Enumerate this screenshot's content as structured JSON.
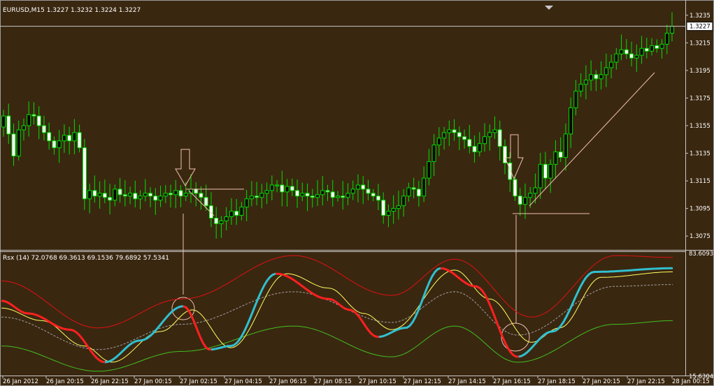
{
  "chart_data": [
    {
      "type": "candlestick",
      "title": "EURUSD,M15  1.3227 1.3232 1.3224 1.3227",
      "ylim": [
        1.3066,
        1.3242
      ],
      "y_ticks": [
        "1.3235",
        "1.3215",
        "1.3195",
        "1.3175",
        "1.3155",
        "1.3135",
        "1.3115",
        "1.3095",
        "1.3075"
      ],
      "last_price": "1.3227",
      "colors": {
        "background": "#3a2710",
        "candle": "#00e000",
        "price_line": "#c8c8c8",
        "annotation": "#f0c0b0"
      },
      "closes": [
        1.3162,
        1.3149,
        1.3133,
        1.3152,
        1.3155,
        1.3163,
        1.3162,
        1.3155,
        1.315,
        1.3144,
        1.3139,
        1.3144,
        1.3148,
        1.3144,
        1.315,
        1.3139,
        1.3102,
        1.3108,
        1.3104,
        1.3106,
        1.3103,
        1.3101,
        1.3109,
        1.3105,
        1.3104,
        1.3106,
        1.3102,
        1.3104,
        1.3106,
        1.3104,
        1.3101,
        1.3104,
        1.3106,
        1.3105,
        1.3108,
        1.3104,
        1.3106,
        1.3109,
        1.3106,
        1.3103,
        1.3097,
        1.3088,
        1.3084,
        1.3086,
        1.3089,
        1.3093,
        1.309,
        1.3096,
        1.3102,
        1.3104,
        1.3103,
        1.3106,
        1.3108,
        1.3112,
        1.3112,
        1.3107,
        1.3111,
        1.3108,
        1.3104,
        1.3106,
        1.3104,
        1.3103,
        1.3105,
        1.3108,
        1.3107,
        1.3103,
        1.3104,
        1.3103,
        1.3106,
        1.3109,
        1.3112,
        1.3109,
        1.3106,
        1.3104,
        1.3101,
        1.309,
        1.3093,
        1.3095,
        1.3097,
        1.3104,
        1.311,
        1.3109,
        1.3104,
        1.3117,
        1.3129,
        1.3141,
        1.3146,
        1.315,
        1.3152,
        1.315,
        1.3147,
        1.3145,
        1.314,
        1.3136,
        1.3142,
        1.3147,
        1.315,
        1.3152,
        1.314,
        1.3128,
        1.3116,
        1.3104,
        1.3098,
        1.3103,
        1.3106,
        1.311,
        1.3127,
        1.3117,
        1.3127,
        1.3136,
        1.3132,
        1.3149,
        1.3168,
        1.318,
        1.3185,
        1.3188,
        1.3192,
        1.3189,
        1.3192,
        1.3197,
        1.3201,
        1.3207,
        1.321,
        1.3207,
        1.3204,
        1.3206,
        1.3211,
        1.3209,
        1.3213,
        1.3211,
        1.3214,
        1.3222,
        1.3227
      ]
    },
    {
      "type": "line",
      "title": "Rsx (14) 72.0768 69.3613 69.1536 79.6892 57.5341",
      "ylim": [
        15.6304,
        83.6093
      ],
      "y_ticks": [
        "83.6093",
        "15.6304"
      ],
      "colors": {
        "upper_band": "#e01010",
        "middle": "#a0a0a0",
        "lower_band": "#40c020",
        "signal": "#ffff60",
        "rsx_up": "#30c0d0",
        "rsx_down": "#ff2020"
      },
      "x": [
        "26 Jan 2012",
        "26 Jan 20:15",
        "26 Jan 22:15",
        "27 Jan 00:15",
        "27 Jan 02:15",
        "27 Jan 04:15",
        "27 Jan 06:15",
        "27 Jan 08:15",
        "27 Jan 10:15",
        "27 Jan 12:15",
        "27 Jan 14:15",
        "27 Jan 16:15",
        "27 Jan 18:15",
        "27 Jan 20:15",
        "27 Jan 22:15",
        "28 Jan 00:15"
      ]
    }
  ]
}
